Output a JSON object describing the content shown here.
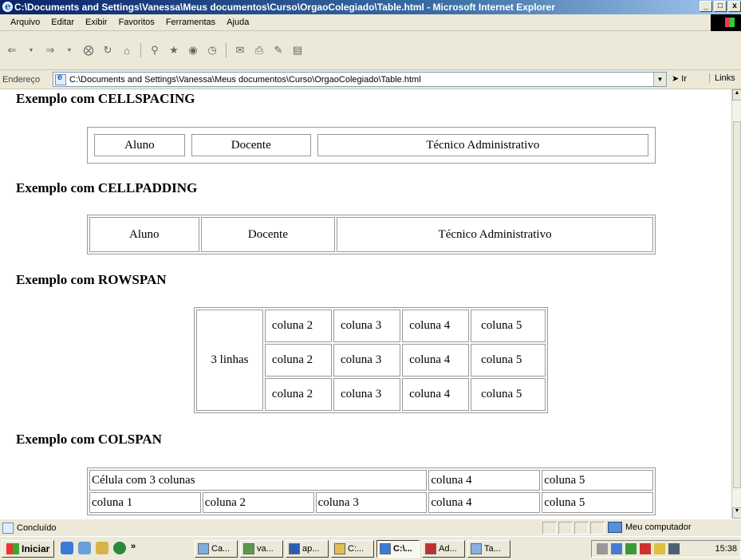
{
  "window": {
    "title": "C:\\Documents and Settings\\Vanessa\\Meus documentos\\Curso\\OrgaoColegiado\\Table.html - Microsoft Internet Explorer",
    "min": "_",
    "max": "□",
    "close": "x"
  },
  "menu": [
    "Arquivo",
    "Editar",
    "Exibir",
    "Favoritos",
    "Ferramentas",
    "Ajuda"
  ],
  "toolbar": {
    "icons": [
      "back-icon",
      "forward-icon",
      "stop-icon",
      "refresh-icon",
      "home-icon",
      "search-icon",
      "favorites-icon",
      "media-icon",
      "history-icon",
      "mail-icon",
      "print-icon",
      "edit-icon",
      "discuss-icon"
    ]
  },
  "address": {
    "label": "Endereço",
    "url": "C:\\Documents and Settings\\Vanessa\\Meus documentos\\Curso\\OrgaoColegiado\\Table.html",
    "go": "Ir",
    "links": "Links"
  },
  "sections": {
    "cellspacing": {
      "heading": "Exemplo com CELLSPACING",
      "cells": [
        "Aluno",
        "Docente",
        "Técnico Administrativo"
      ]
    },
    "cellpadding": {
      "heading": "Exemplo com CELLPADDING",
      "cells": [
        "Aluno",
        "Docente",
        "Técnico Administrativo"
      ]
    },
    "rowspan": {
      "heading": "Exemplo com ROWSPAN",
      "span_cell": "3 linhas",
      "rows": [
        [
          "coluna 2",
          "coluna 3",
          "coluna 4",
          "coluna 5"
        ],
        [
          "coluna 2",
          "coluna 3",
          "coluna 4",
          "coluna 5"
        ],
        [
          "coluna 2",
          "coluna 3",
          "coluna 4",
          "coluna 5"
        ]
      ]
    },
    "colspan": {
      "heading": "Exemplo com COLSPAN",
      "row1": [
        "Célula com 3 colunas",
        "coluna 4",
        "coluna 5"
      ],
      "row2": [
        "coluna 1",
        "coluna 2",
        "coluna 3",
        "coluna 4",
        "coluna 5"
      ]
    }
  },
  "status": {
    "text": "Concluído",
    "zone": "Meu computador"
  },
  "taskbar": {
    "start": "Iniciar",
    "chevron": "»",
    "tasks": [
      "Ca...",
      "va...",
      "ap...",
      "C:...",
      "C:\\...",
      "Ad...",
      "Ta..."
    ],
    "clock": "15:38"
  }
}
